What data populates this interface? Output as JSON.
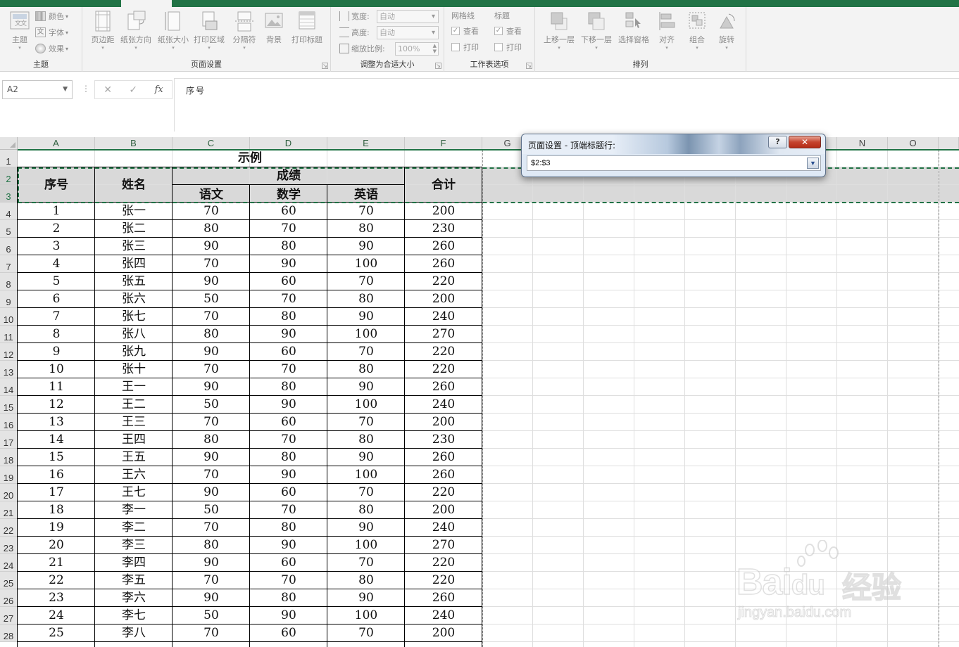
{
  "ribbon": {
    "groups": {
      "theme": {
        "label": "主题",
        "themes_label": "主题",
        "colors_label": "颜色",
        "fonts_label": "字体",
        "effects_label": "效果"
      },
      "page_setup": {
        "label": "页面设置",
        "buttons": [
          "页边距",
          "纸张方向",
          "纸张大小",
          "打印区域",
          "分隔符",
          "背景",
          "打印标题"
        ]
      },
      "scale_to_fit": {
        "label": "调整为合适大小",
        "width_label": "宽度:",
        "width_value": "自动",
        "height_label": "高度:",
        "height_value": "自动",
        "scale_label": "缩放比例:",
        "scale_value": "100%"
      },
      "sheet_options": {
        "label": "工作表选项",
        "gridlines_label": "网格线",
        "headings_label": "标题",
        "view_label": "查看",
        "print_label": "打印"
      },
      "arrange": {
        "label": "排列",
        "buttons": [
          "上移一层",
          "下移一层",
          "选择窗格",
          "对齐",
          "组合",
          "旋转"
        ]
      }
    }
  },
  "formula_bar": {
    "name_box": "A2",
    "cancel_symbol": "✕",
    "enter_symbol": "✓",
    "fx_label": "fx",
    "content": "序号"
  },
  "sheet": {
    "columns": [
      "A",
      "B",
      "C",
      "D",
      "E",
      "F",
      "G",
      "N",
      "O"
    ],
    "rows": [
      "1",
      "2",
      "3",
      "4",
      "5",
      "6",
      "7",
      "8",
      "9",
      "10",
      "11",
      "12",
      "13",
      "14",
      "15",
      "16",
      "17",
      "18",
      "19",
      "20",
      "21",
      "22",
      "23",
      "24",
      "25",
      "26",
      "27",
      "28"
    ],
    "title": "示例",
    "header": {
      "no": "序号",
      "name": "姓名",
      "scores": "成绩",
      "chinese": "语文",
      "math": "数学",
      "english": "英语",
      "total": "合计"
    },
    "data": [
      [
        "1",
        "张一",
        "70",
        "60",
        "70",
        "200"
      ],
      [
        "2",
        "张二",
        "80",
        "70",
        "80",
        "230"
      ],
      [
        "3",
        "张三",
        "90",
        "80",
        "90",
        "260"
      ],
      [
        "4",
        "张四",
        "70",
        "90",
        "100",
        "260"
      ],
      [
        "5",
        "张五",
        "90",
        "60",
        "70",
        "220"
      ],
      [
        "6",
        "张六",
        "50",
        "70",
        "80",
        "200"
      ],
      [
        "7",
        "张七",
        "70",
        "80",
        "90",
        "240"
      ],
      [
        "8",
        "张八",
        "80",
        "90",
        "100",
        "270"
      ],
      [
        "9",
        "张九",
        "90",
        "60",
        "70",
        "220"
      ],
      [
        "10",
        "张十",
        "70",
        "70",
        "80",
        "220"
      ],
      [
        "11",
        "王一",
        "90",
        "80",
        "90",
        "260"
      ],
      [
        "12",
        "王二",
        "50",
        "90",
        "100",
        "240"
      ],
      [
        "13",
        "王三",
        "70",
        "60",
        "70",
        "200"
      ],
      [
        "14",
        "王四",
        "80",
        "70",
        "80",
        "230"
      ],
      [
        "15",
        "王五",
        "90",
        "80",
        "90",
        "260"
      ],
      [
        "16",
        "王六",
        "70",
        "90",
        "100",
        "260"
      ],
      [
        "17",
        "王七",
        "90",
        "60",
        "70",
        "220"
      ],
      [
        "18",
        "李一",
        "50",
        "70",
        "80",
        "200"
      ],
      [
        "19",
        "李二",
        "70",
        "80",
        "90",
        "240"
      ],
      [
        "20",
        "李三",
        "80",
        "90",
        "100",
        "270"
      ],
      [
        "21",
        "李四",
        "90",
        "60",
        "70",
        "220"
      ],
      [
        "22",
        "李五",
        "70",
        "70",
        "80",
        "220"
      ],
      [
        "23",
        "李六",
        "90",
        "80",
        "90",
        "260"
      ],
      [
        "24",
        "李七",
        "50",
        "90",
        "100",
        "240"
      ],
      [
        "25",
        "李八",
        "70",
        "60",
        "70",
        "200"
      ]
    ]
  },
  "dialog": {
    "title": "页面设置 - 顶端标题行:",
    "help_symbol": "?",
    "close_symbol": "✕",
    "input_value": "$2:$3",
    "collapse_symbol": "▼"
  },
  "watermark": {
    "main": "Bai",
    "mid": "du",
    "cn": "经验",
    "url": "jingyan.baidu.com"
  },
  "colors": {
    "accent": "#217346",
    "header_fill": "#d9d9d9",
    "dialog_close": "#c5442f"
  },
  "icons": [
    "themes-icon",
    "colors-icon",
    "fonts-icon",
    "effects-icon",
    "margins-icon",
    "orientation-icon",
    "size-icon",
    "print-area-icon",
    "breaks-icon",
    "background-icon",
    "print-titles-icon",
    "bring-forward-icon",
    "send-backward-icon",
    "selection-pane-icon",
    "align-icon",
    "group-icon",
    "rotate-icon",
    "collapse-dialog-icon"
  ]
}
